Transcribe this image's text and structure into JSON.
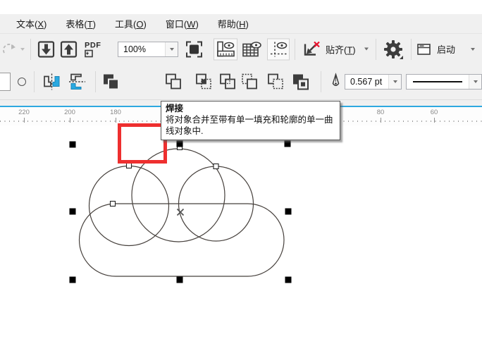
{
  "menu": {
    "items": [
      {
        "label_pre": "文本(",
        "mnemonic": "X",
        "label_post": ")"
      },
      {
        "label_pre": "表格(",
        "mnemonic": "T",
        "label_post": ")"
      },
      {
        "label_pre": "工具(",
        "mnemonic": "O",
        "label_post": ")"
      },
      {
        "label_pre": "窗口(",
        "mnemonic": "W",
        "label_post": ")"
      },
      {
        "label_pre": "帮助(",
        "mnemonic": "H",
        "label_post": ")"
      }
    ]
  },
  "toolbar_standard": {
    "pdf_label": "PDF",
    "zoom_value": "100%",
    "snap_label_pre": "贴齐(",
    "snap_mnemonic": "T",
    "snap_label_post": ")",
    "launch_label": "启动"
  },
  "toolbar_property": {
    "outline_width": "0.567 pt"
  },
  "tooltip": {
    "title": "焊接",
    "body_line1": "将对象合并至带有单一填充和轮廓的单一曲",
    "body_line2": "线对象中."
  },
  "ruler": {
    "labels": [
      "220",
      "200",
      "180",
      "80",
      "60"
    ]
  },
  "colors": {
    "accent_cyan": "#29a8e0",
    "highlight_red": "#ee2f2f",
    "icon_dark": "#3d3d3d",
    "weld_button_bg": "#d9ebf9"
  }
}
